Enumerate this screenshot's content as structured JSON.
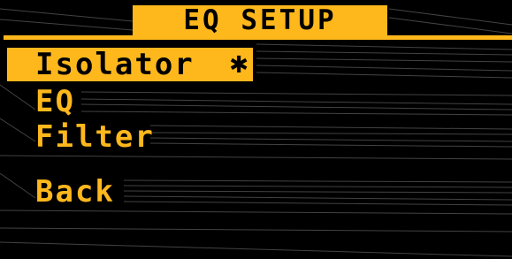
{
  "header": {
    "title": "EQ SETUP"
  },
  "menu": {
    "items": [
      {
        "label": "Isolator",
        "marker": "✱",
        "selected": true
      },
      {
        "label": "EQ",
        "selected": false
      },
      {
        "label": "Filter",
        "selected": false
      },
      {
        "label": "Back",
        "selected": false
      }
    ]
  },
  "colors": {
    "accent": "#FFB81C",
    "background": "#000000",
    "selected_text": "#000000"
  }
}
